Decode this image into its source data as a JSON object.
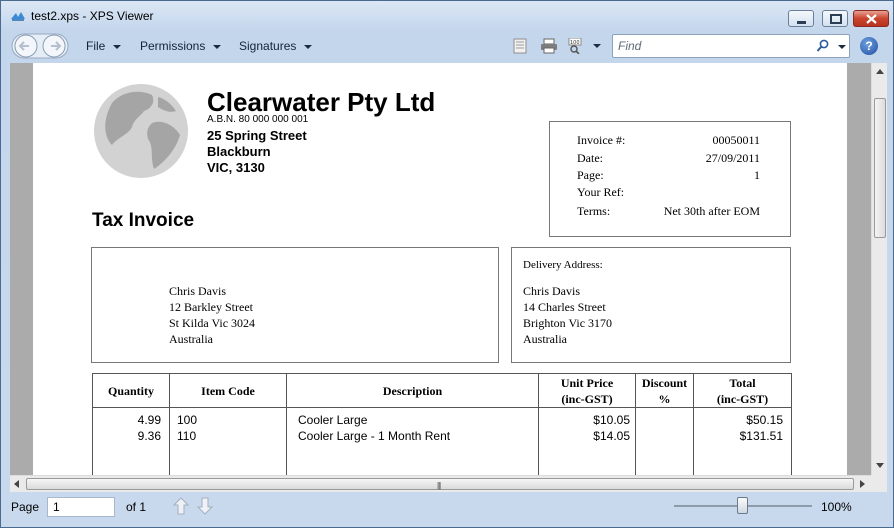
{
  "window": {
    "title": "test2.xps - XPS Viewer"
  },
  "toolbar": {
    "menus": [
      "File",
      "Permissions",
      "Signatures"
    ],
    "find_placeholder": "Find",
    "help_label": "?"
  },
  "invoice": {
    "company": "Clearwater Pty Ltd",
    "abn": "A.B.N.  80 000 000 001",
    "address": [
      "25 Spring Street",
      "Blackburn",
      "VIC, 3130"
    ],
    "doc_title": "Tax Invoice",
    "meta": [
      {
        "label": "Invoice #:",
        "value": "00050011"
      },
      {
        "label": "Date:",
        "value": "27/09/2011"
      },
      {
        "label": "Page:",
        "value": "1"
      },
      {
        "label": "Your Ref:",
        "value": ""
      },
      {
        "label": "Terms:",
        "value": "Net 30th after EOM"
      }
    ],
    "customer": [
      "Chris Davis",
      "12 Barkley Street",
      "St Kilda  Vic  3024",
      "Australia"
    ],
    "delivery_label": "Delivery Address:",
    "delivery": [
      "Chris Davis",
      "14 Charles Street",
      "Brighton  Vic  3170",
      "Australia"
    ],
    "columns": {
      "quantity": "Quantity",
      "item_code": "Item Code",
      "description": "Description",
      "unit_price_1": "Unit Price",
      "unit_price_2": "(inc-GST)",
      "discount_1": "Discount",
      "discount_2": "%",
      "total_1": "Total",
      "total_2": "(inc-GST)"
    },
    "rows": [
      {
        "quantity": "4.99",
        "item_code": "100",
        "description": "Cooler Large",
        "unit_price": "$10.05",
        "discount": "",
        "total": "$50.15"
      },
      {
        "quantity": "9.36",
        "item_code": "110",
        "description": "Cooler Large - 1 Month Rent",
        "unit_price": "$14.05",
        "discount": "",
        "total": "$131.51"
      }
    ]
  },
  "statusbar": {
    "page_label": "Page",
    "page_value": "1",
    "of_label": "of 1",
    "zoom": "100%"
  }
}
